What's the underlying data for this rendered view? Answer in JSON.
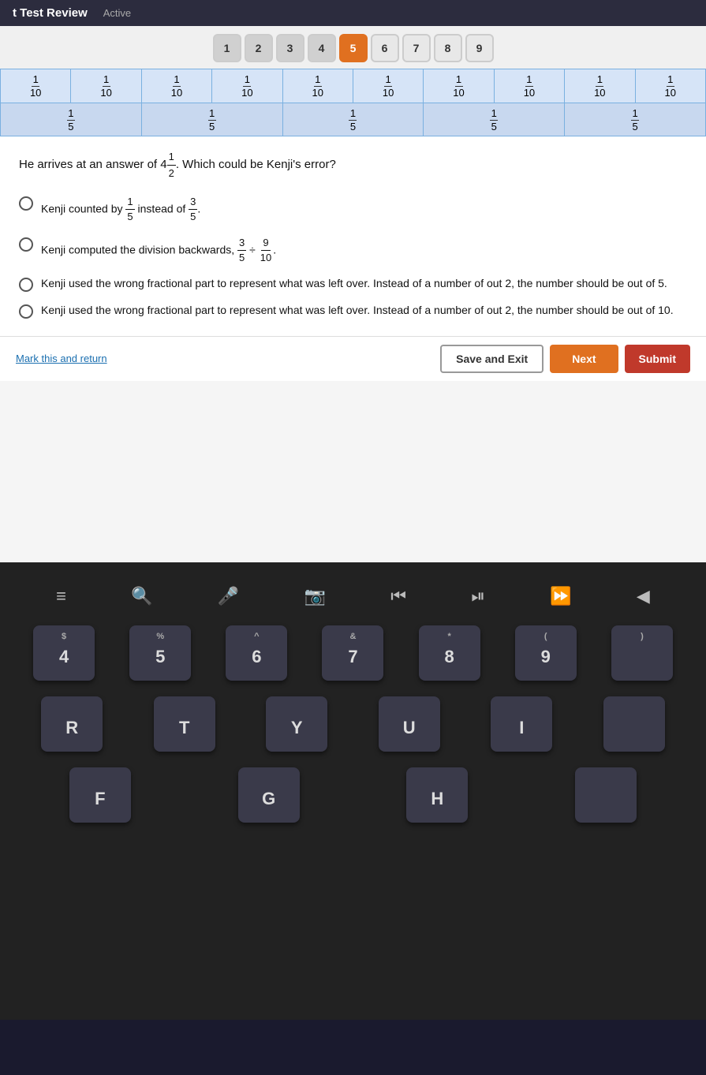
{
  "topbar": {
    "title": "t Test Review",
    "status": "Active"
  },
  "question_nav": {
    "buttons": [
      {
        "label": "1",
        "state": "visited"
      },
      {
        "label": "2",
        "state": "visited"
      },
      {
        "label": "3",
        "state": "visited"
      },
      {
        "label": "4",
        "state": "visited"
      },
      {
        "label": "5",
        "state": "active"
      },
      {
        "label": "6",
        "state": "default"
      },
      {
        "label": "7",
        "state": "default"
      },
      {
        "label": "8",
        "state": "default"
      },
      {
        "label": "9",
        "state": "default"
      }
    ]
  },
  "fraction_table": {
    "row1": [
      "1/10",
      "1/10",
      "1/10",
      "1/10",
      "1/10",
      "1/10",
      "1/10",
      "1/10",
      "1/10",
      "1/10"
    ],
    "row2": [
      "1/5",
      "",
      "1/5",
      "",
      "1/5",
      "",
      "1/5",
      "",
      "1/5",
      ""
    ]
  },
  "question": {
    "text": "He arrives at an answer of 4½. Which could be Kenji's error?",
    "choices": [
      {
        "id": "A",
        "text": "Kenji counted by 1/5 instead of 3/5."
      },
      {
        "id": "B",
        "text": "Kenji computed the division backwards, 3/5 ÷ 9/10."
      },
      {
        "id": "C",
        "text": "Kenji used the wrong fractional part to represent what was left over. Instead of a number of out 2, the number should be out of 5."
      },
      {
        "id": "D",
        "text": "Kenji used the wrong fractional part to represent what was left over. Instead of a number of out 2, the number should be out of 10."
      }
    ]
  },
  "bottom": {
    "mark_link": "Mark this and return",
    "save_exit": "Save and Exit",
    "next": "Next",
    "submit": "Submit"
  },
  "keyboard": {
    "icons": [
      "≡",
      "🔍",
      "🎤",
      "📷",
      "⏮",
      "⏭",
      "⏩"
    ],
    "row1": [
      {
        "top": "$",
        "main": "4"
      },
      {
        "top": "%",
        "main": "5"
      },
      {
        "top": "^",
        "main": "6"
      },
      {
        "top": "&",
        "main": "7"
      },
      {
        "top": "*",
        "main": "8"
      },
      {
        "top": "(",
        "main": "9"
      }
    ],
    "row2": [
      {
        "top": "",
        "main": "R"
      },
      {
        "top": "",
        "main": "T"
      },
      {
        "top": "",
        "main": "Y"
      },
      {
        "top": "",
        "main": "U"
      },
      {
        "top": "",
        "main": "I"
      }
    ],
    "row3": [
      {
        "top": "",
        "main": "F"
      },
      {
        "top": "",
        "main": "G"
      },
      {
        "top": "",
        "main": "H"
      }
    ]
  }
}
